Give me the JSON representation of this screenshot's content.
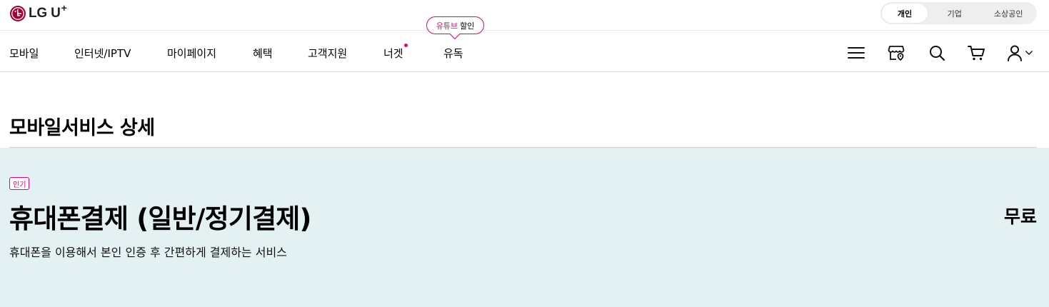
{
  "header": {
    "logo_text": "LG U",
    "logo_plus": "+",
    "segments": [
      {
        "label": "개인",
        "active": true
      },
      {
        "label": "기업",
        "active": false
      },
      {
        "label": "소상공인",
        "active": false
      }
    ]
  },
  "nav": {
    "items": [
      {
        "label": "모바일"
      },
      {
        "label": "인터넷/IPTV"
      },
      {
        "label": "마이페이지"
      },
      {
        "label": "혜택"
      },
      {
        "label": "고객지원"
      },
      {
        "label": "너겟",
        "has_dot": true
      },
      {
        "label": "유독"
      }
    ],
    "promo_bubble": {
      "highlight": "유튜브",
      "text": "할인"
    },
    "icons": [
      "menu-icon",
      "store-location-icon",
      "search-icon",
      "cart-icon",
      "user-icon",
      "chevron-down-icon"
    ]
  },
  "page": {
    "title": "모바일서비스 상세"
  },
  "service": {
    "badge": "인기",
    "title": "휴대폰결제 (일반/정기결제)",
    "price": "무료",
    "description": "휴대폰을 이용해서 본인 인증 후 간편하게 결제하는 서비스"
  },
  "colors": {
    "accent": "#e6007e",
    "brand": "#e6007e",
    "panel_bg": "#e4f1f3"
  }
}
